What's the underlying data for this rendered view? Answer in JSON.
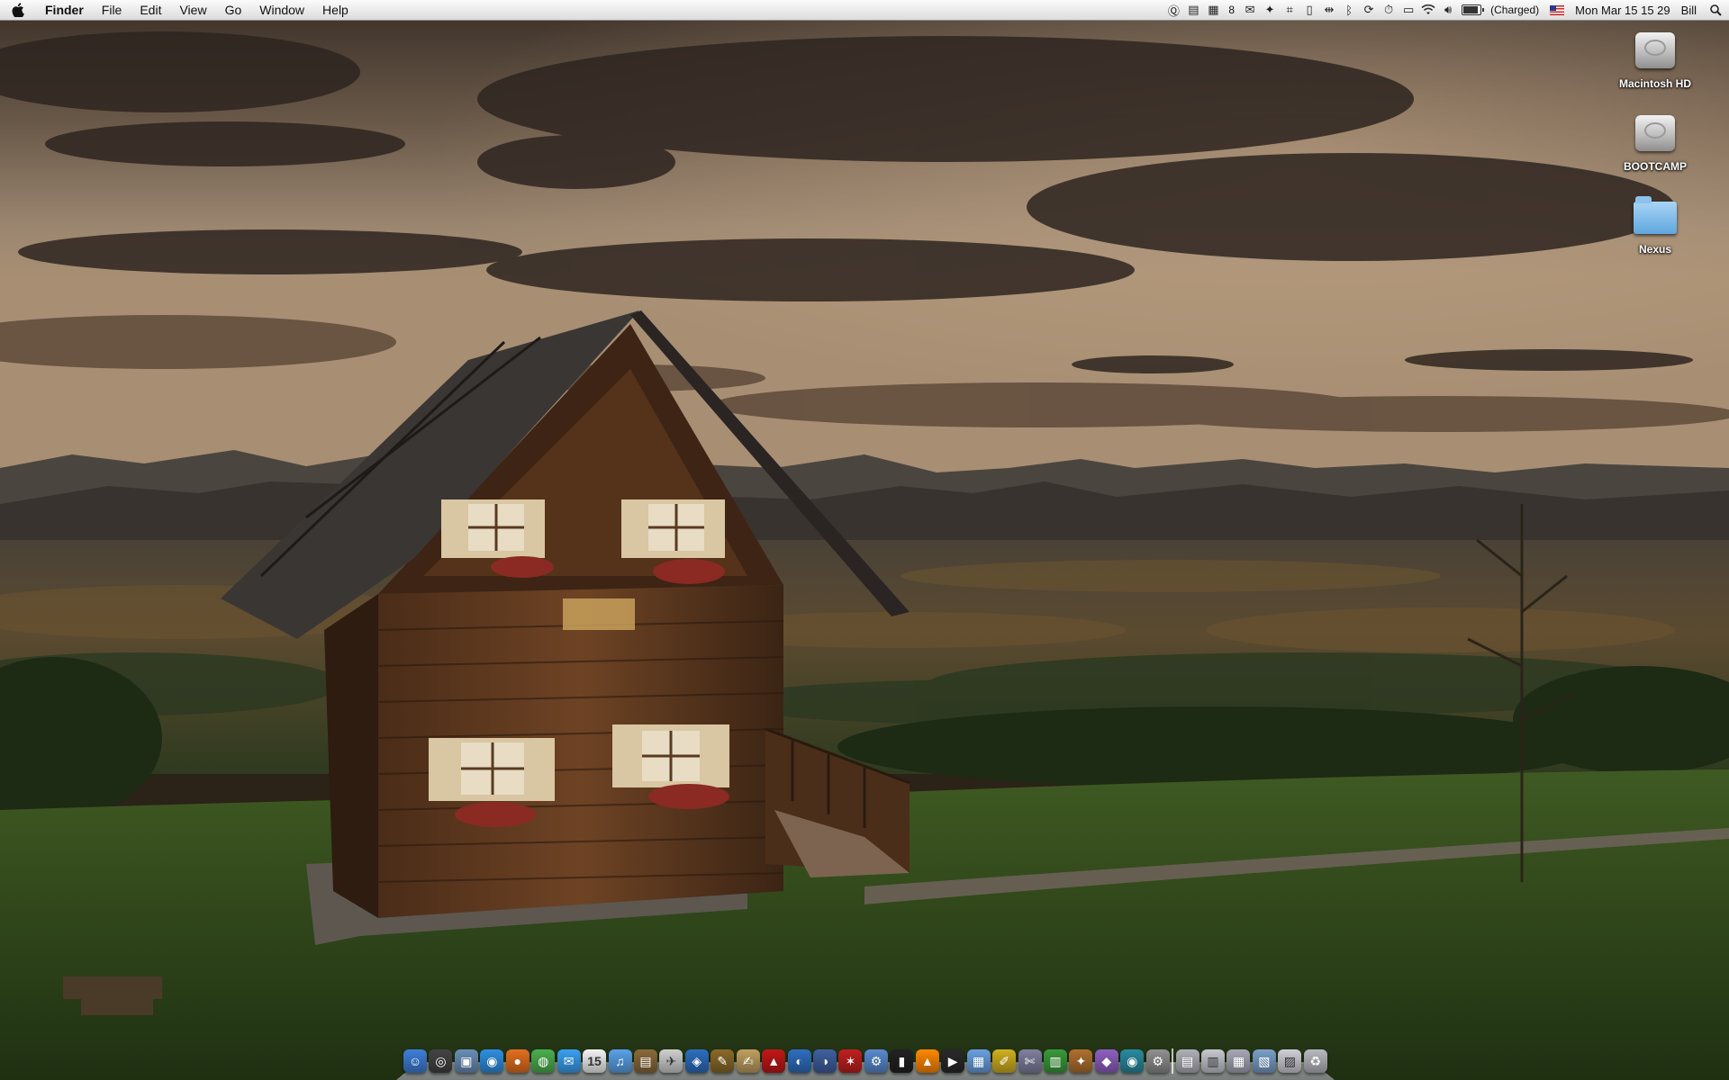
{
  "menubar": {
    "apple_icon": "apple-icon",
    "app_name": "Finder",
    "menus": [
      "File",
      "Edit",
      "View",
      "Go",
      "Window",
      "Help"
    ],
    "status": {
      "calendar_badge": "8",
      "battery_label": "(Charged)",
      "datetime": "Mon Mar 15  15 29",
      "user": "Bill"
    }
  },
  "desktop_icons": [
    {
      "label": "Macintosh HD",
      "icon": "hard-drive-icon"
    },
    {
      "label": "BOOTCAMP",
      "icon": "hard-drive-icon"
    },
    {
      "label": "Nexus",
      "icon": "folder-icon"
    }
  ],
  "dock": {
    "apps": [
      {
        "name": "finder-icon",
        "color": "#3f7fd8",
        "glyph": "☺"
      },
      {
        "name": "dashboard-icon",
        "color": "#444444",
        "glyph": "◎"
      },
      {
        "name": "preview-icon",
        "color": "#6a8fb8",
        "glyph": "▣"
      },
      {
        "name": "safari-icon",
        "color": "#2f8fe0",
        "glyph": "◉"
      },
      {
        "name": "firefox-icon",
        "color": "#e2701f",
        "glyph": "●"
      },
      {
        "name": "chrome-icon",
        "color": "#4caf50",
        "glyph": "◍"
      },
      {
        "name": "ichat-icon",
        "color": "#3aa0f0",
        "glyph": "✉"
      },
      {
        "name": "ical-icon",
        "color": "#f4f4f4",
        "glyph": "15"
      },
      {
        "name": "itunes-icon",
        "color": "#5aa2e8",
        "glyph": "♫"
      },
      {
        "name": "iphoto-icon",
        "color": "#8a6a3a",
        "glyph": "▤"
      },
      {
        "name": "skype-icon",
        "color": "#d0d0d0",
        "glyph": "✈"
      },
      {
        "name": "vlc-icon",
        "color": "#2e6fbf",
        "glyph": "◈"
      },
      {
        "name": "utility-icon",
        "color": "#8a6a2a",
        "glyph": "✎"
      },
      {
        "name": "textedit-icon",
        "color": "#c0a060",
        "glyph": "✍"
      },
      {
        "name": "acrobat-icon",
        "color": "#c01818",
        "glyph": "▲"
      },
      {
        "name": "earth-icon",
        "color": "#2f6fbf",
        "glyph": "◐"
      },
      {
        "name": "world-icon",
        "color": "#4060a0",
        "glyph": "◑"
      },
      {
        "name": "app-red-icon",
        "color": "#c02020",
        "glyph": "✶"
      },
      {
        "name": "system-icon",
        "color": "#5a8ad0",
        "glyph": "⚙"
      },
      {
        "name": "terminal-icon",
        "color": "#222222",
        "glyph": "▮"
      },
      {
        "name": "vlc-cone-icon",
        "color": "#ff8800",
        "glyph": "▲"
      },
      {
        "name": "movie-icon",
        "color": "#2a2a2a",
        "glyph": "▶"
      },
      {
        "name": "document-icon",
        "color": "#6aa0e0",
        "glyph": "▦"
      },
      {
        "name": "notes-icon",
        "color": "#d0b020",
        "glyph": "✐"
      },
      {
        "name": "tools-icon",
        "color": "#8080a0",
        "glyph": "✄"
      },
      {
        "name": "activity-icon",
        "color": "#3a9a3a",
        "glyph": "▥"
      },
      {
        "name": "stamp-icon",
        "color": "#b07030",
        "glyph": "✦"
      },
      {
        "name": "image-icon",
        "color": "#9060c0",
        "glyph": "◆"
      },
      {
        "name": "globe-icon",
        "color": "#2a8aa0",
        "glyph": "◉"
      },
      {
        "name": "prefs-icon",
        "color": "#909090",
        "glyph": "⚙"
      }
    ],
    "stacks": [
      {
        "name": "stack-documents-icon",
        "color": "#b0b0b8",
        "glyph": "▤"
      },
      {
        "name": "stack-files-icon",
        "color": "#c8c8d0",
        "glyph": "▥"
      },
      {
        "name": "stack-folder-icon",
        "color": "#a8a8b8",
        "glyph": "▦"
      },
      {
        "name": "stack-pictures-icon",
        "color": "#7aa0c8",
        "glyph": "▧"
      },
      {
        "name": "stack-downloads-icon",
        "color": "#d0d0d8",
        "glyph": "▨"
      },
      {
        "name": "trash-icon",
        "color": "#b8b8c0",
        "glyph": "♻"
      }
    ]
  }
}
